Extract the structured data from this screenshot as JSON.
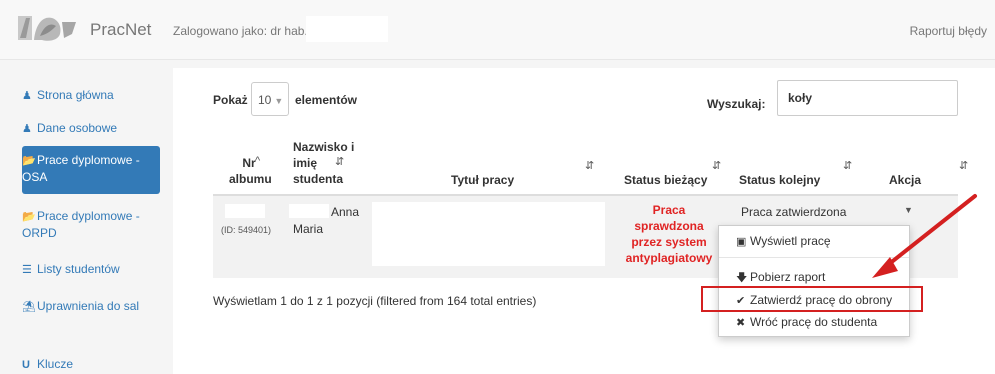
{
  "topbar": {
    "brand": "PracNet",
    "logged_in_as": "Zalogowano jako: dr hab.",
    "report_bugs": "Raportuj błędy"
  },
  "sidebar": {
    "items": [
      {
        "label": "Strona główna",
        "icon": "user-icon"
      },
      {
        "label": "Dane osobowe",
        "icon": "user-icon"
      },
      {
        "label": "Prace dyplomowe - OSA",
        "icon": "folder-open-icon",
        "active": true
      },
      {
        "label": "Prace dyplomowe - ORPD",
        "icon": "folder-open-icon"
      },
      {
        "label": "Listy studentów",
        "icon": "list-icon"
      },
      {
        "label": "Uprawnienia do sal",
        "icon": "building-icon"
      },
      {
        "label": "Klucze",
        "icon": "magnet-icon"
      }
    ]
  },
  "table_controls": {
    "show_label": "Pokaż",
    "page_length": "10",
    "elements_label": "elementów",
    "search_label": "Wyszukaj:",
    "search_value": "koły"
  },
  "table": {
    "headers": [
      "Nr albumu",
      "Nazwisko i imię studenta",
      "Tytuł pracy",
      "Status bieżący",
      "Status kolejny",
      "Akcja"
    ],
    "rows": [
      {
        "album_id": "(ID: 549401)",
        "first_name": "Anna",
        "second_name": "Maria",
        "status_current": "Praca sprawdzona przez system antyplagiatowy",
        "status_next": "Praca zatwierdzona"
      }
    ],
    "info": "Wyświetlam 1 do 1 z 1 pozycji (filtered from 164 total entries)"
  },
  "action_menu": {
    "items": [
      {
        "label": "Wyświetl pracę",
        "icon": "image-icon"
      },
      {
        "label": "Pobierz raport",
        "icon": "download-arrow-icon"
      },
      {
        "label": "Zatwierdź pracę do obrony",
        "icon": "check-icon",
        "highlighted": true
      },
      {
        "label": "Wróć pracę do studenta",
        "icon": "close-icon"
      }
    ]
  },
  "colors": {
    "accent": "#337ab7",
    "status_red": "#e02424",
    "annotation_red": "#d42020"
  }
}
